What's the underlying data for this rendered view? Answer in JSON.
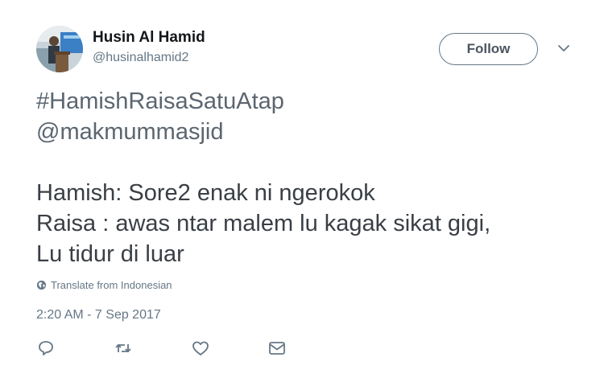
{
  "user": {
    "name": "Husin Al Hamid",
    "handle": "@husinalhamid2",
    "avatar_icon": "profile-photo"
  },
  "follow_label": "Follow",
  "menu_icon": "chevron-down-icon",
  "tweet": {
    "lines": [
      "#HamishRaisaSatuAtap",
      "@makmummasjid",
      "",
      "Hamish: Sore2 enak ni ngerokok",
      "Raisa : awas ntar malem lu kagak sikat gigi,",
      "Lu tidur di luar"
    ]
  },
  "translate_label": "Translate from Indonesian",
  "timestamp": "2:20 AM - 7 Sep 2017",
  "actions": [
    "reply-icon",
    "retweet-icon",
    "like-icon",
    "message-icon"
  ],
  "colors": {
    "text": "#14171a",
    "secondary": "#657786",
    "border": "#657786"
  }
}
